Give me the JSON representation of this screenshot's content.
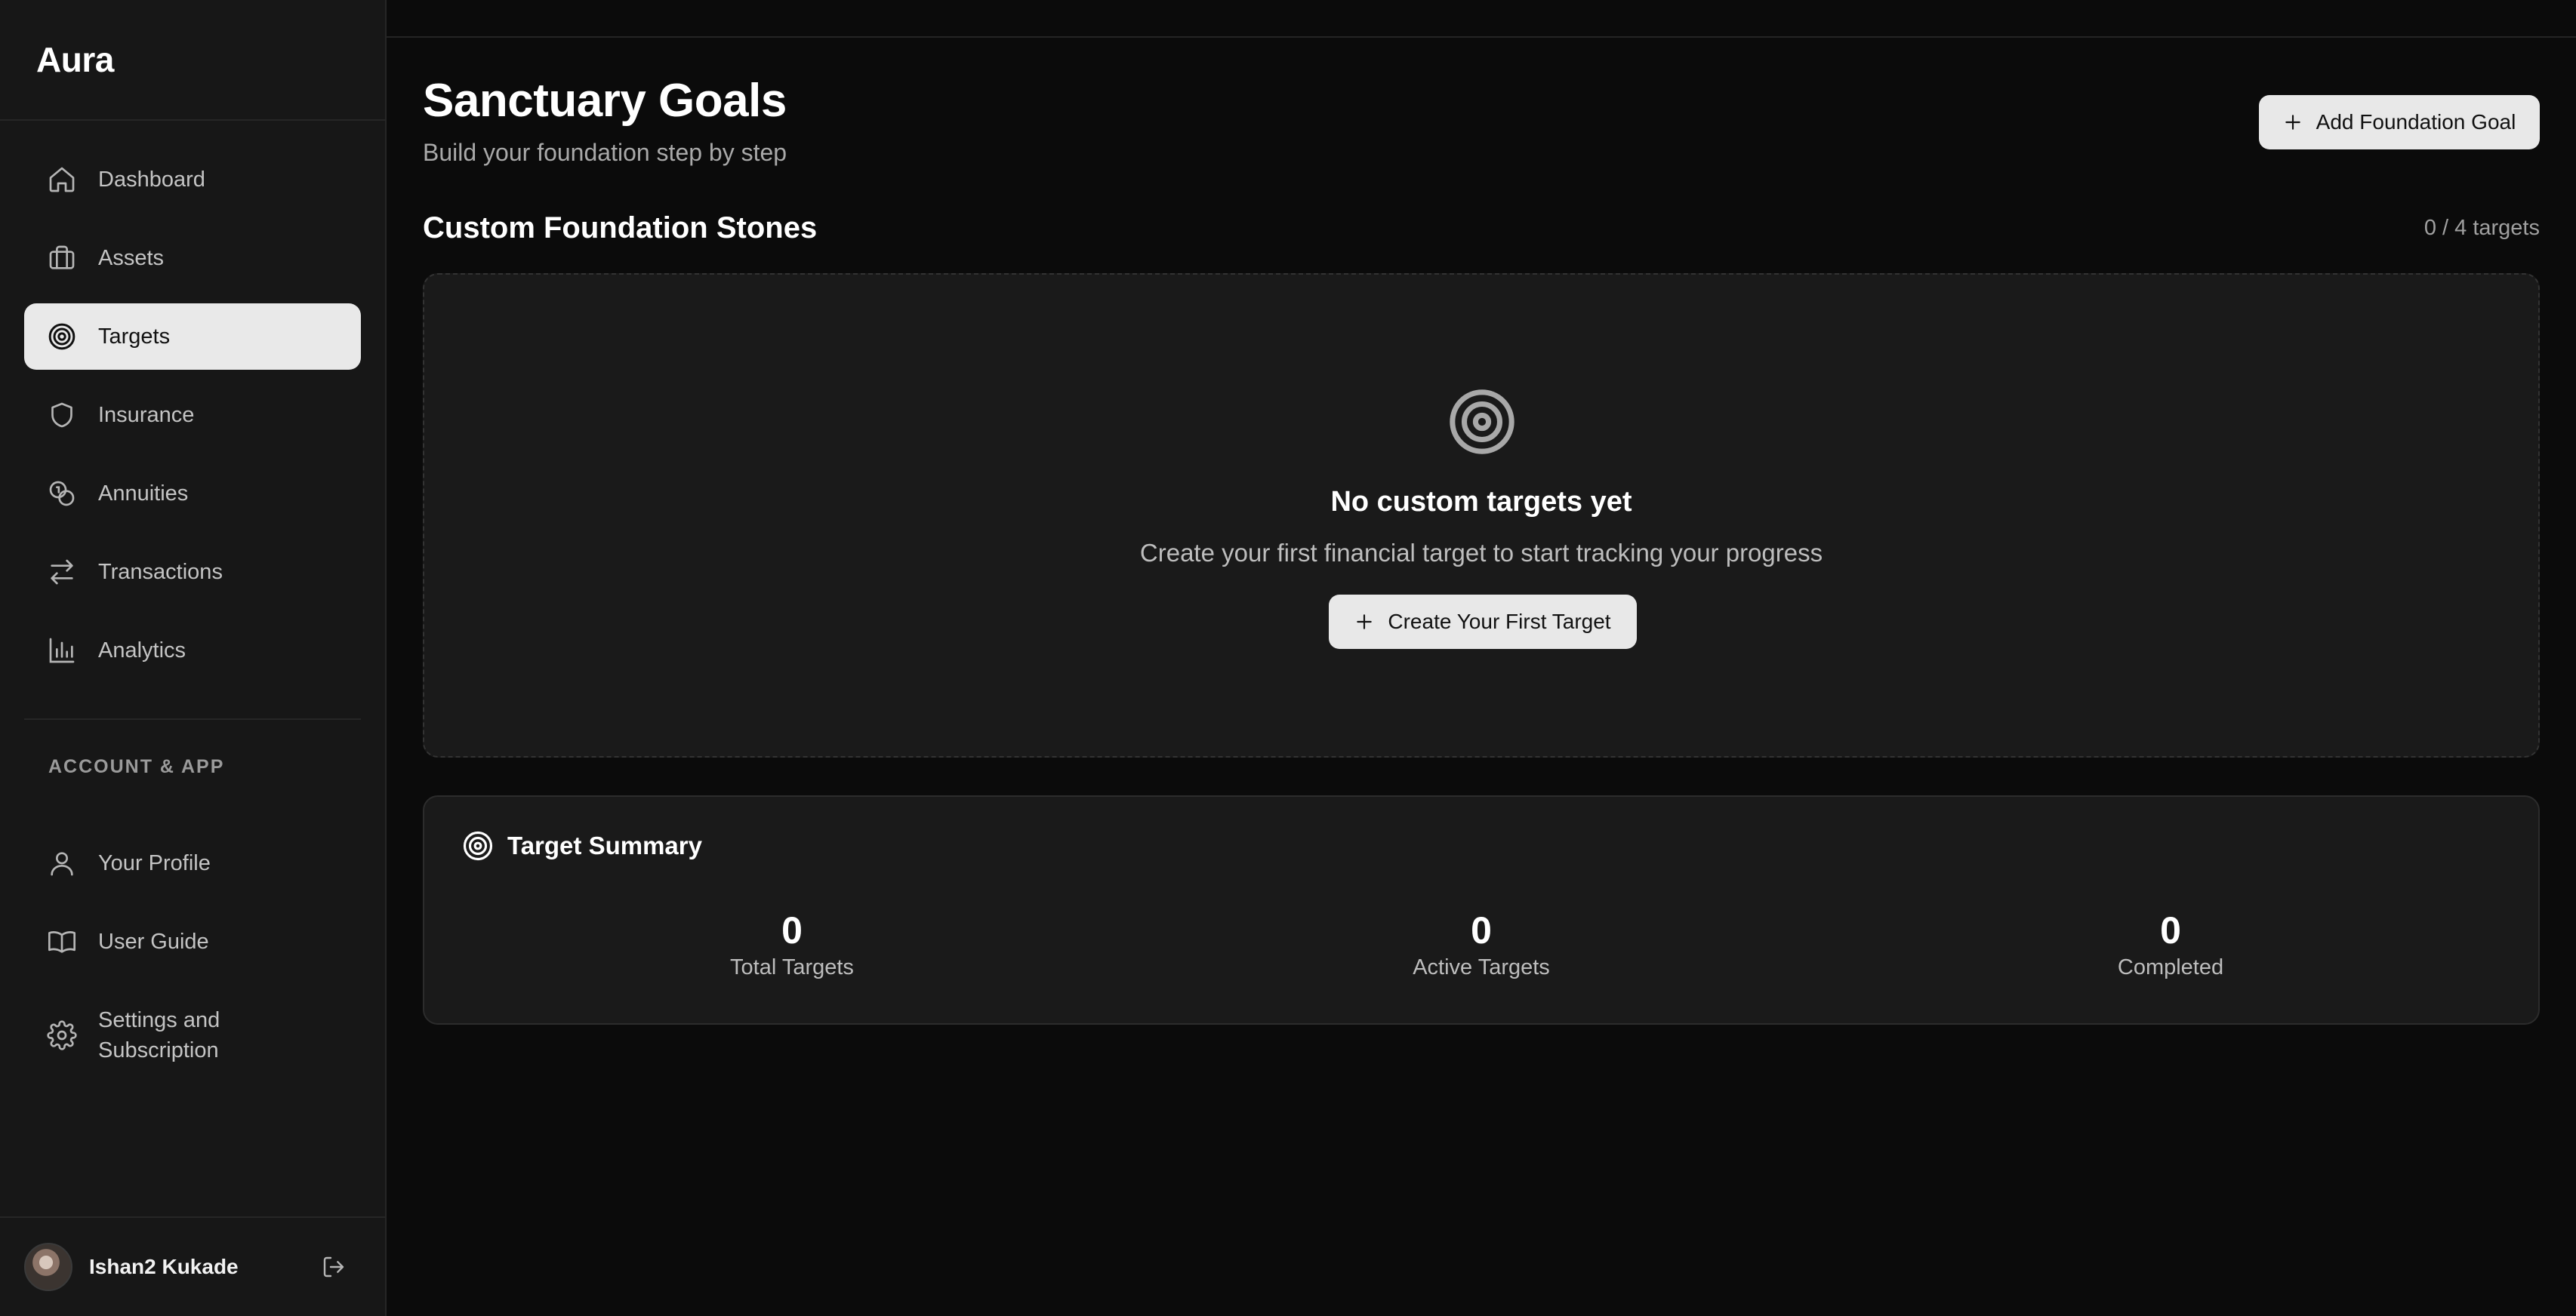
{
  "app": {
    "name": "Aura"
  },
  "sidebar": {
    "items": [
      {
        "label": "Dashboard",
        "icon": "home-icon"
      },
      {
        "label": "Assets",
        "icon": "briefcase-icon"
      },
      {
        "label": "Targets",
        "icon": "target-icon",
        "active": true
      },
      {
        "label": "Insurance",
        "icon": "shield-icon"
      },
      {
        "label": "Annuities",
        "icon": "coins-icon"
      },
      {
        "label": "Transactions",
        "icon": "arrows-left-right-icon"
      },
      {
        "label": "Analytics",
        "icon": "bar-chart-icon"
      }
    ],
    "section_label": "ACCOUNT & APP",
    "account_items": [
      {
        "label": "Your Profile",
        "icon": "user-icon"
      },
      {
        "label": "User Guide",
        "icon": "book-open-icon"
      },
      {
        "label": "Settings and Subscription",
        "line1": "Settings and",
        "line2": "Subscription",
        "icon": "gear-icon"
      }
    ],
    "user": {
      "name": "Ishan2 Kukade",
      "logout_icon": "logout-icon"
    }
  },
  "header": {
    "title": "Sanctuary Goals",
    "subtitle": "Build your foundation step by step",
    "add_button_label": "Add Foundation Goal"
  },
  "custom_section": {
    "title": "Custom Foundation Stones",
    "count_text": "0 / 4 targets",
    "empty_state": {
      "title": "No custom targets yet",
      "description": "Create your first financial target to start tracking your progress",
      "button_label": "Create Your First Target"
    }
  },
  "summary": {
    "title": "Target Summary",
    "stats": [
      {
        "value": "0",
        "label": "Total Targets"
      },
      {
        "value": "0",
        "label": "Active Targets"
      },
      {
        "value": "0",
        "label": "Completed"
      }
    ]
  },
  "colors": {
    "background": "#0b0b0b",
    "sidebar": "#171717",
    "card": "#1a1a1a",
    "active_nav": "#e9e9e9",
    "button": "#e8e8e8"
  }
}
